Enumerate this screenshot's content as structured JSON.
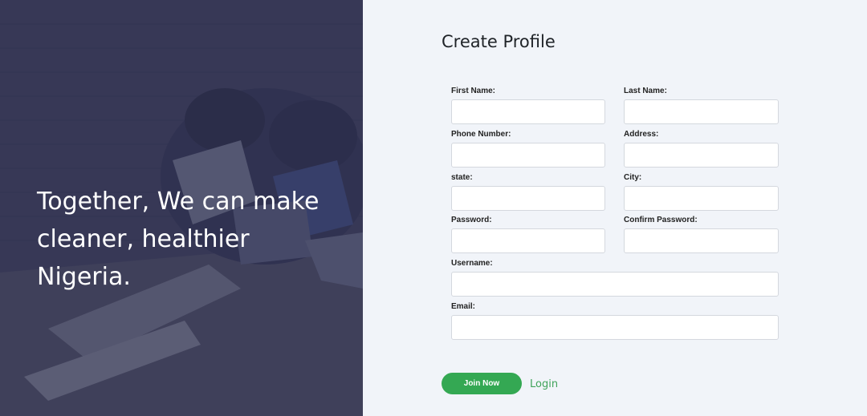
{
  "hero": {
    "tagline_line1": "Together, We can make",
    "tagline_line2": "cleaner, healthier Nigeria."
  },
  "form": {
    "title": "Create Profile",
    "fields": {
      "first_name": {
        "label": "First Name:",
        "value": ""
      },
      "last_name": {
        "label": "Last Name:",
        "value": ""
      },
      "phone": {
        "label": "Phone Number:",
        "value": ""
      },
      "address": {
        "label": "Address:",
        "value": ""
      },
      "state": {
        "label": "state:",
        "value": ""
      },
      "city": {
        "label": "City:",
        "value": ""
      },
      "password": {
        "label": "Password:",
        "value": ""
      },
      "confirm_password": {
        "label": "Confirm Password:",
        "value": ""
      },
      "username": {
        "label": "Username:",
        "value": ""
      },
      "email": {
        "label": "Email:",
        "value": ""
      }
    },
    "join_label": "Join Now",
    "login_label": "Login"
  },
  "colors": {
    "accent": "#34a853",
    "hero_overlay": "#2a2c50",
    "panel_bg": "#f1f4f9"
  }
}
